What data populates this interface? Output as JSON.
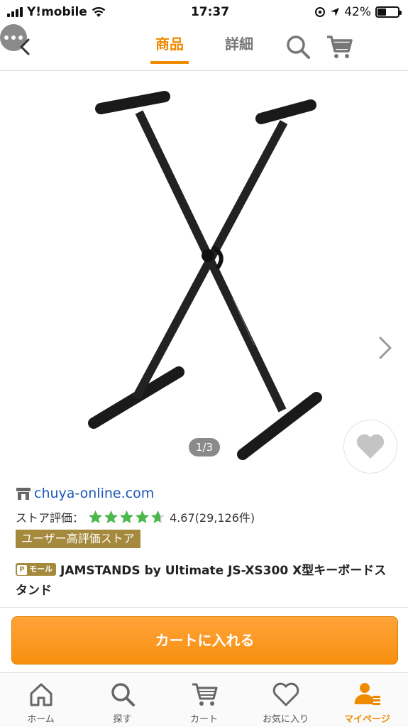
{
  "status_bar": {
    "carrier": "Y!mobile",
    "time": "17:37",
    "battery": "42%",
    "battery_level": 0.42
  },
  "header": {
    "tabs": [
      {
        "label": "商品",
        "active": true
      },
      {
        "label": "詳細",
        "active": false
      }
    ],
    "icons": [
      "back-chevron-icon",
      "search-icon",
      "cart-icon",
      "more-icon"
    ]
  },
  "gallery": {
    "counter": "1/3",
    "image_subject": "x-stand-image"
  },
  "store": {
    "name": "chuya-online.com",
    "rating_label": "ストア評価：",
    "rating_value": "4.67(29,126件)",
    "stars": 4.67,
    "badge": "ユーザー高評価ストア"
  },
  "product": {
    "mall_tag": "モール",
    "title": "JAMSTANDS by Ultimate JS-XS300 X型キーボードスタンド"
  },
  "actions": {
    "add_to_cart": "カートに入れる"
  },
  "tab_bar": {
    "items": [
      {
        "label": "ホーム",
        "icon": "home-icon"
      },
      {
        "label": "探す",
        "icon": "search-icon"
      },
      {
        "label": "カート",
        "icon": "cart-icon"
      },
      {
        "label": "お気に入り",
        "icon": "heart-icon"
      },
      {
        "label": "マイページ",
        "icon": "user-icon",
        "active": true
      }
    ]
  },
  "colors": {
    "accent": "#f08a00",
    "link": "#1a56b8",
    "badge": "#a58a3e",
    "star": "#4cb84c"
  }
}
